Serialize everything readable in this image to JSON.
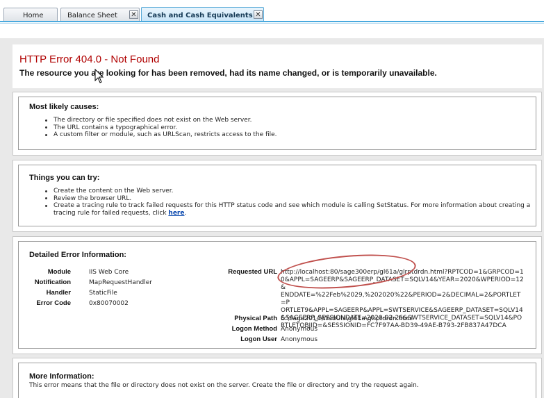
{
  "tabs": [
    {
      "label": "Home"
    },
    {
      "label": "Balance Sheet",
      "close": "✕"
    },
    {
      "label": "Cash and Cash Equivalents",
      "close": "✕"
    }
  ],
  "error": {
    "title": "HTTP Error 404.0 - Not Found",
    "subtitle": "The resource you are looking for has been removed, had its name changed, or is temporarily unavailable."
  },
  "causes": {
    "heading": "Most likely causes:",
    "items": [
      "The directory or file specified does not exist on the Web server.",
      "The URL contains a typographical error.",
      "A custom filter or module, such as URLScan, restricts access to the file."
    ]
  },
  "try": {
    "heading": "Things you can try:",
    "items": [
      "Create the content on the Web server.",
      "Review the browser URL."
    ],
    "last_item": "Create a tracing rule to track failed requests for this HTTP status code and see which module is calling SetStatus. For more information about creating a tracing rule for failed requests, click",
    "link_text": "here",
    "link_suffix": "."
  },
  "details": {
    "heading": "Detailed Error Information:",
    "left": [
      {
        "label": "Module",
        "value": "IIS Web Core"
      },
      {
        "label": "Notification",
        "value": "MapRequestHandler"
      },
      {
        "label": "Handler",
        "value": "StaticFile"
      },
      {
        "label": "Error Code",
        "value": "0x80070002"
      }
    ],
    "requested_url_label": "Requested URL",
    "requested_url_lines": [
      "http://localhost:80/sage300erp/gl61a/glrptdrdn.html?RPTCOD=1&GRPCOD=1",
      "0&APPL=SAGEERP&SAGEERP_DATASET=SQLV14&YEAR=2020&WPERIOD=12&",
      "ENDDATE=%22Feb%2029,%202020%22&PERIOD=2&DECIMAL=2&PORTLET=P",
      "ORTLET9&APPL=SAGEERP&APPL=SWTSERVICE&SAGEERP_DATASET=SQLV14",
      "&SAGEERP_SESSIONDATE=2020-02-26&SWTSERVICE_DATASET=SQLV14&PO",
      "RTLETOBJID=&SESSIONID=FC7F97AA-BD39-49AE-B793-2FB837A47DCA"
    ],
    "right": [
      {
        "label": "Physical Path",
        "value": "E:\\Sage2014\\WebUIs\\gl61a\\glrptdrdn.html"
      },
      {
        "label": "Logon Method",
        "value": "Anonymous"
      },
      {
        "label": "Logon User",
        "value": "Anonymous"
      }
    ]
  },
  "more": {
    "heading": "More Information:",
    "text": "This error means that the file or directory does not exist on the server. Create the file or directory and try the request again."
  },
  "colors": {
    "error_title": "#b00000",
    "tab_accent": "#49a9de",
    "annotation_oval": "#c0504d"
  }
}
